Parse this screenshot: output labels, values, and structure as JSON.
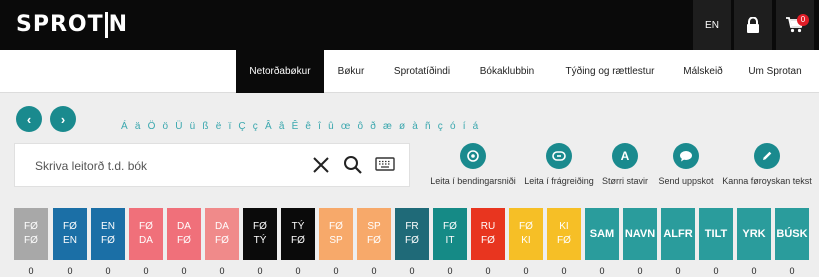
{
  "header": {
    "logo_left": "SPROT",
    "logo_right": "N",
    "lang": "EN",
    "cart_count": "0"
  },
  "nav": {
    "items": [
      "Netorðabøkur",
      "Bøkur",
      "Sprotatíðindi",
      "Bókaklubbin",
      "Týðing og rættlestur",
      "Málskeið",
      "Um Sprotan"
    ],
    "active_index": 0
  },
  "letters": "Á ä Ö ö Ü ü ß ë ï Ç ç Â â Ê ê î û œ ô ð æ ø à ñ ç ó í á",
  "search": {
    "placeholder": "Skriva leitorð t.d. bók"
  },
  "tools": [
    {
      "icon": "target-icon",
      "label": "Leita í bendingarsniði"
    },
    {
      "icon": "link-icon",
      "label": "Leita í frágreiðing"
    },
    {
      "icon": "letter-a-icon",
      "label": "Størri stavir"
    },
    {
      "icon": "chat-icon",
      "label": "Send uppskot"
    },
    {
      "icon": "pencil-icon",
      "label": "Kanna føroyskan tekst"
    }
  ],
  "dictionaries": [
    {
      "line1": "FØ",
      "line2": "FØ",
      "color": "#a8a8a8"
    },
    {
      "line1": "FØ",
      "line2": "EN",
      "color": "#1b6fa6"
    },
    {
      "line1": "EN",
      "line2": "FØ",
      "color": "#1b6fa6"
    },
    {
      "line1": "FØ",
      "line2": "DA",
      "color": "#f0707a"
    },
    {
      "line1": "DA",
      "line2": "FØ",
      "color": "#f0707a"
    },
    {
      "line1": "DA",
      "line2": "FØ",
      "color": "#f08a8a"
    },
    {
      "line1": "FØ",
      "line2": "TÝ",
      "color": "#0a0a0a"
    },
    {
      "line1": "TÝ",
      "line2": "FØ",
      "color": "#0a0a0a"
    },
    {
      "line1": "FØ",
      "line2": "SP",
      "color": "#f7a96a"
    },
    {
      "line1": "SP",
      "line2": "FØ",
      "color": "#f7a96a"
    },
    {
      "line1": "FR",
      "line2": "FØ",
      "color": "#1f6a78"
    },
    {
      "line1": "FØ",
      "line2": "IT",
      "color": "#158a86"
    },
    {
      "line1": "RU",
      "line2": "FØ",
      "color": "#e8351f"
    },
    {
      "line1": "FØ",
      "line2": "KI",
      "color": "#f6bf26"
    },
    {
      "line1": "KI",
      "line2": "FØ",
      "color": "#f6bf26"
    },
    {
      "line1": "SAM",
      "line2": "",
      "color": "#2a9c9c"
    },
    {
      "line1": "NAVN",
      "line2": "",
      "color": "#2a9c9c"
    },
    {
      "line1": "ALFR",
      "line2": "",
      "color": "#2a9c9c"
    },
    {
      "line1": "TILT",
      "line2": "",
      "color": "#2a9c9c"
    },
    {
      "line1": "YRK",
      "line2": "",
      "color": "#2a9c9c"
    },
    {
      "line1": "BÚSK",
      "line2": "",
      "color": "#2a9c9c"
    }
  ],
  "counts": [
    "0",
    "0",
    "0",
    "0",
    "0",
    "0",
    "0",
    "0",
    "0",
    "0",
    "0",
    "0",
    "0",
    "0",
    "0",
    "0",
    "0",
    "0",
    "0",
    "0",
    "0"
  ]
}
